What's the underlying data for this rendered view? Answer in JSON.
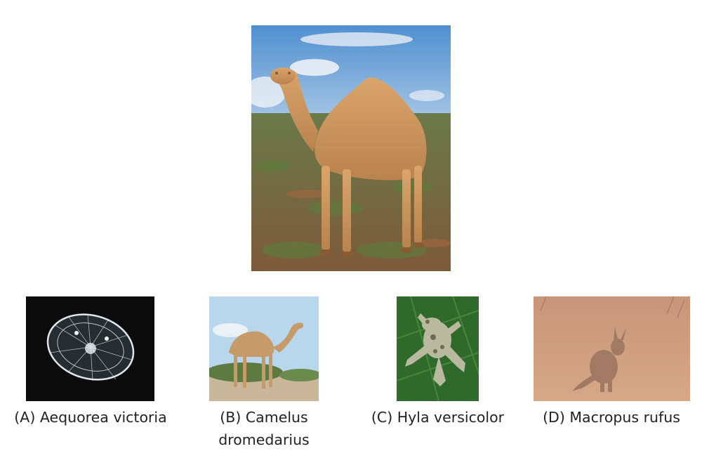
{
  "question_image": {
    "icon": "camel-photo"
  },
  "options": [
    {
      "letter": "(A)",
      "name": "Aequorea victoria",
      "icon": "jellyfish-photo"
    },
    {
      "letter": "(B)",
      "name": "Camelus dromedarius",
      "icon": "camel-photo"
    },
    {
      "letter": "(C)",
      "name": "Hyla versicolor",
      "icon": "tree-frog-photo"
    },
    {
      "letter": "(D)",
      "name": "Macropus rufus",
      "icon": "kangaroo-photo"
    }
  ],
  "captions": {
    "a": "(A) Aequorea victoria",
    "b_line1": "(B) Camelus",
    "b_line2": "dromedarius",
    "c": "(C) Hyla versicolor",
    "d": "(D) Macropus rufus"
  }
}
